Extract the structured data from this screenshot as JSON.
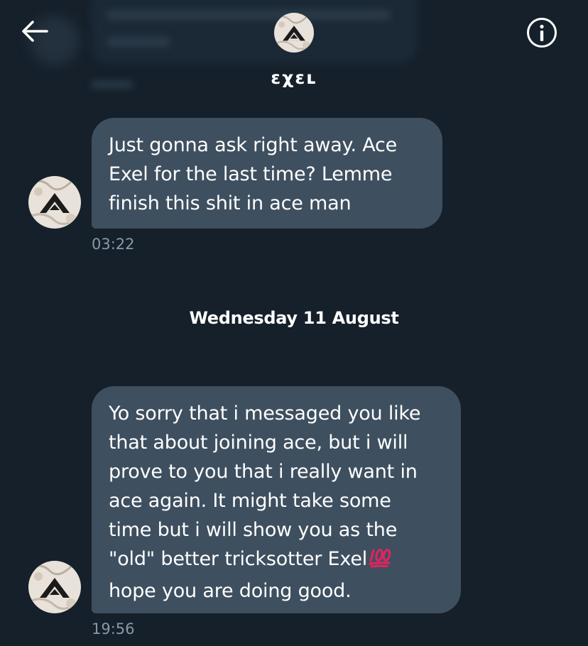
{
  "header": {
    "name": "ɛχɛʟ",
    "back_icon": "arrow-left-icon",
    "info_icon": "info-icon"
  },
  "messages": [
    {
      "lines": [
        "Just gonna ask right away. Ace",
        "Exel for the last time? Lemme",
        "finish this shit in ace man"
      ],
      "time": "03:22"
    },
    {
      "lines": [
        "Yo sorry that i messaged you like",
        "that about joining ace, but i will",
        "prove to you that i really want in",
        "ace again. It might take some",
        "time but i will show you as the",
        "\"old\" better tricksotter Exel",
        "hope you are doing good."
      ],
      "emoji": "hundred-points-emoji",
      "time": "19:56"
    }
  ],
  "date_divider": "Wednesday 11 August",
  "colors": {
    "background": "#15202b",
    "bubble": "#3e4f5f",
    "timestamp": "#8899a6",
    "text": "#ffffff"
  }
}
